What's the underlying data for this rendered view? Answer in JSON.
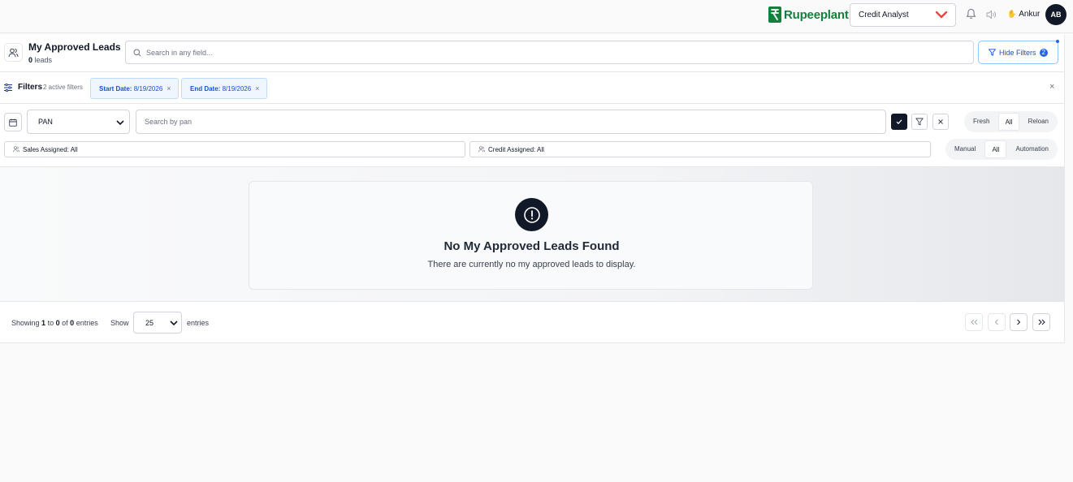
{
  "topbar": {
    "brand": "Rupeeplant",
    "role": "Credit Analyst",
    "user_name": "Ankur",
    "avatar_initials": "AB",
    "colors": {
      "brand_green": "#15803d",
      "chevron_red": "#ef4444",
      "dark": "#111827"
    }
  },
  "header": {
    "title": "My Approved Leads",
    "lead_count": "0",
    "lead_count_suffix": "leads",
    "search_placeholder": "Search in any field...",
    "hide_filters_label": "Hide Filters",
    "active_filter_badge": "2"
  },
  "filters": {
    "label": "Filters",
    "active_count_text": "2 active filters",
    "chips": [
      {
        "label": "Start Date:",
        "value": "8/19/2026",
        "remove": "×"
      },
      {
        "label": "End Date:",
        "value": "8/19/2026",
        "remove": "×"
      }
    ],
    "clear_all": "×",
    "field_select": "PAN",
    "pan_placeholder": "Search by pan",
    "lead_type": {
      "options": [
        "Fresh",
        "All",
        "Reloan"
      ],
      "selected": "All"
    },
    "mode": {
      "options": [
        "Manual",
        "All",
        "Automation"
      ],
      "selected": "All"
    },
    "sales_assigned": "Sales Assigned: All",
    "credit_assigned": "Credit Assigned: All"
  },
  "empty_state": {
    "icon": "alert-circle-icon",
    "title": "No My Approved Leads Found",
    "message": "There are currently no my approved leads to display."
  },
  "footer": {
    "showing_prefix": "Showing",
    "from": "1",
    "to_word": "to",
    "to": "0",
    "of_word": "of",
    "total": "0",
    "entries_word": "entries",
    "show_label": "Show",
    "page_size": "25",
    "entries_label": "entries"
  }
}
